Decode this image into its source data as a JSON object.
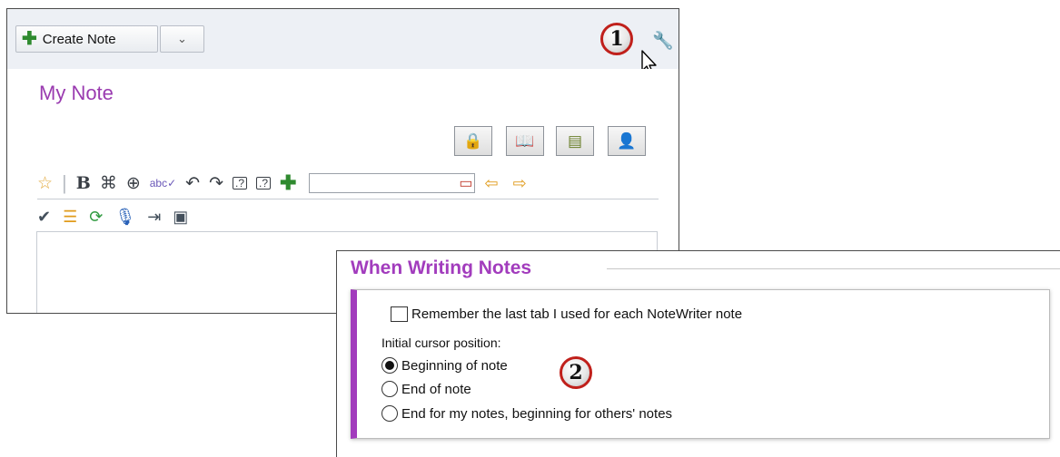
{
  "toolbar": {
    "create_note_label": "Create Note",
    "dropdown_glyph": "⌄",
    "callout_1": "1",
    "settings_icon": "wrench-icon"
  },
  "note": {
    "title": "My Note"
  },
  "settings": {
    "section_title": "When Writing Notes",
    "remember_tab_label": "Remember the last tab I used for each NoteWriter note",
    "remember_tab_checked": false,
    "cursor_position_label": "Initial cursor position:",
    "cursor_options": [
      {
        "label": "Beginning of note",
        "selected": true
      },
      {
        "label": "End of note",
        "selected": false
      },
      {
        "label": "End for my notes, beginning for others' notes",
        "selected": false
      }
    ],
    "callout_2": "2"
  },
  "colors": {
    "accent_purple": "#a23cbd",
    "callout_ring": "#c0201b",
    "create_plus_green": "#2f8a2f"
  }
}
